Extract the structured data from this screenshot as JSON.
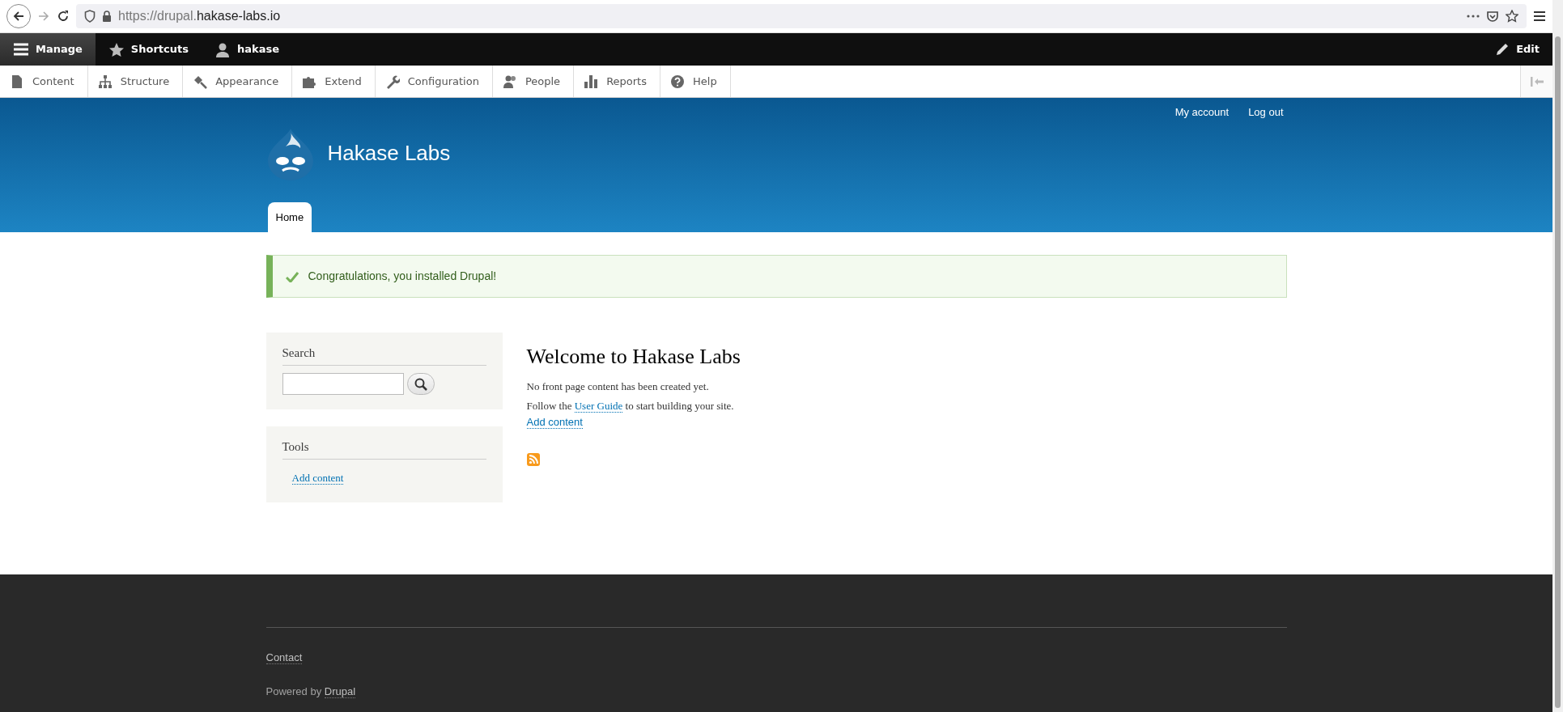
{
  "browser": {
    "url_scheme": "https://drupal.",
    "url_host": "hakase-labs.io"
  },
  "toolbar": {
    "items": [
      {
        "label": "Manage",
        "kind": "menu",
        "selected": true
      },
      {
        "label": "Shortcuts",
        "kind": "star",
        "selected": false
      },
      {
        "label": "hakase",
        "kind": "user",
        "selected": false
      }
    ],
    "edit": "Edit"
  },
  "tray": [
    {
      "label": "Content",
      "kind": "file"
    },
    {
      "label": "Structure",
      "kind": "sitemap"
    },
    {
      "label": "Appearance",
      "kind": "brush"
    },
    {
      "label": "Extend",
      "kind": "puzzle"
    },
    {
      "label": "Configuration",
      "kind": "wrench"
    },
    {
      "label": "People",
      "kind": "people"
    },
    {
      "label": "Reports",
      "kind": "bars"
    },
    {
      "label": "Help",
      "kind": "help"
    }
  ],
  "header": {
    "account_links": [
      "My account",
      "Log out"
    ],
    "site_name": "Hakase Labs",
    "tabs": [
      {
        "label": "Home",
        "selected": true
      }
    ]
  },
  "message": "Congratulations, you installed Drupal!",
  "sidebar": {
    "search_title": "Search",
    "tools_title": "Tools",
    "tools_links": [
      "Add content"
    ]
  },
  "main": {
    "title": "Welcome to Hakase Labs",
    "text": "No front page content has been created yet.",
    "follow_prefix": "Follow the",
    "follow_link": "User Guide",
    "follow_suffix": "to start building your site.",
    "add_link": "Add content"
  },
  "footer": {
    "contact": "Contact",
    "powered_prefix": "Powered by",
    "powered_link": "Drupal"
  }
}
